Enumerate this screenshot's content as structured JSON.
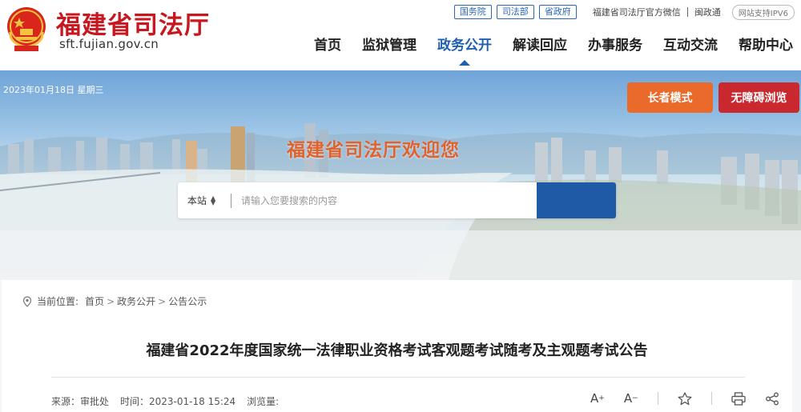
{
  "header": {
    "site_title": "福建省司法厅",
    "site_domain": "sft.fujian.gov.cn",
    "gov_links": [
      "国务院",
      "司法部",
      "省政府"
    ],
    "wechat_link": "福建省司法厅官方微信",
    "minzhengtong_link": "闽政通",
    "ipv6_badge": "网站支持IPV6"
  },
  "nav": {
    "items": [
      {
        "label": "首页",
        "active": false
      },
      {
        "label": "监狱管理",
        "active": false
      },
      {
        "label": "政务公开",
        "active": true
      },
      {
        "label": "解读回应",
        "active": false
      },
      {
        "label": "办事服务",
        "active": false
      },
      {
        "label": "互动交流",
        "active": false
      },
      {
        "label": "帮助中心",
        "active": false
      }
    ]
  },
  "banner": {
    "date": "2023年01月18日 星期三",
    "elder_mode_label": "长者模式",
    "accessibility_label": "无障碍浏览",
    "welcome_text": "福建省司法厅欢迎您"
  },
  "search": {
    "scope": "本站",
    "placeholder": "请输入您要搜索的内容",
    "icon": "search-icon"
  },
  "breadcrumb": {
    "prefix": "当前位置:",
    "items": [
      "首页",
      "政务公开",
      "公告公示"
    ]
  },
  "article": {
    "title": "福建省2022年度国家统一法律职业资格考试客观题考试随考及主观题考试公告",
    "source": "来源：审批处",
    "time": "时间：2023-01-18 15:24",
    "views": "浏览量:"
  },
  "tools": {
    "font_increase": "A",
    "font_decrease": "A"
  },
  "colors": {
    "brand_red": "#c8171e",
    "nav_active_blue": "#1e5fb0",
    "elder_orange": "#e96a2a",
    "access_red": "#c9282f",
    "search_blue": "#1f5aa6"
  }
}
